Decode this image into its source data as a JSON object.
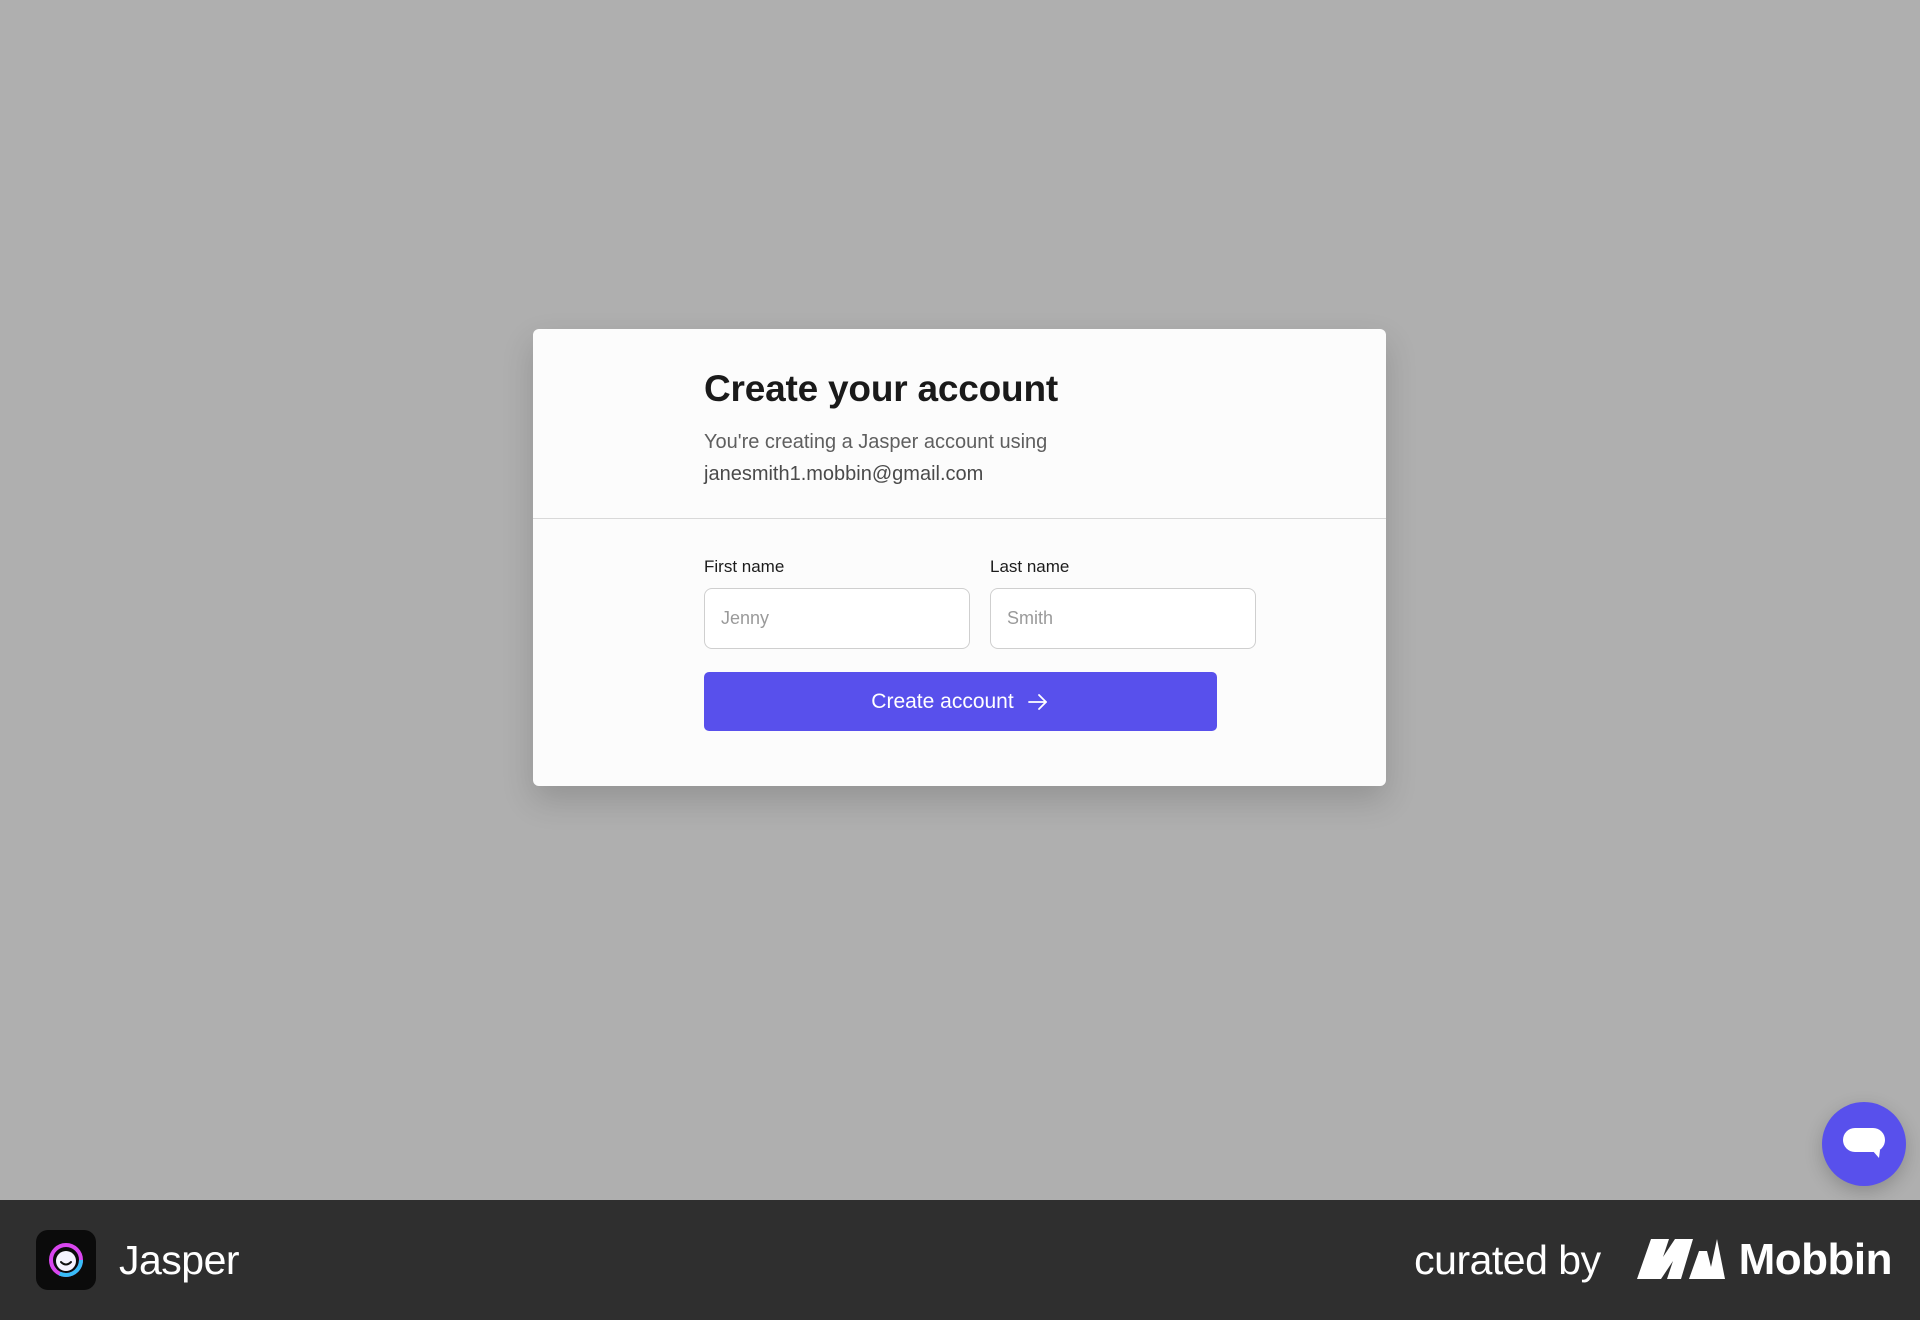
{
  "modal": {
    "title": "Create your account",
    "subtitle": "You're creating a Jasper account using",
    "email": "janesmith1.mobbin@gmail.com",
    "first_name": {
      "label": "First name",
      "placeholder": "Jenny",
      "value": ""
    },
    "last_name": {
      "label": "Last name",
      "placeholder": "Smith",
      "value": ""
    },
    "submit_label": "Create account",
    "accent_color": "#5850ec"
  },
  "chat": {
    "icon": "chat-bubble-icon"
  },
  "footer": {
    "app_name": "Jasper",
    "app_icon": "jasper-logo-icon",
    "curated_by": "curated by",
    "curator_name": "Mobbin",
    "curator_icon": "mobbin-logo-icon"
  }
}
